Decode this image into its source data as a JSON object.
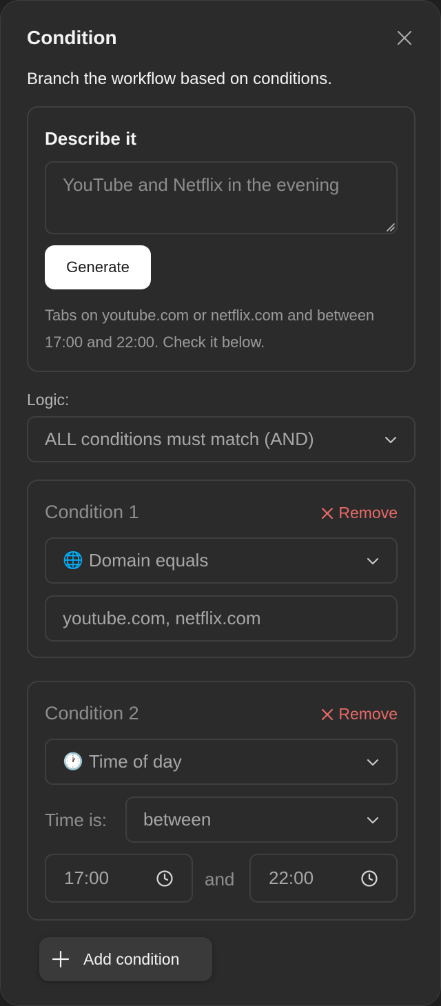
{
  "header": {
    "title": "Condition",
    "subtitle": "Branch the workflow based on conditions."
  },
  "describe": {
    "title": "Describe it",
    "placeholder": "YouTube and Netflix in the evening",
    "generate_label": "Generate",
    "hint": "Tabs on youtube.com or netflix.com and between 17:00 and 22:00. Check it below."
  },
  "logic": {
    "label": "Logic:",
    "selected": "ALL conditions must match (AND)"
  },
  "conditions": [
    {
      "title": "Condition 1",
      "remove_label": "Remove",
      "type_icon": "🌐",
      "type_label": "Domain equals",
      "value_placeholder": "youtube.com, netflix.com"
    },
    {
      "title": "Condition 2",
      "remove_label": "Remove",
      "type_icon": "🕐",
      "type_label": "Time of day",
      "time_label": "Time is:",
      "operator": "between",
      "start": "17:00",
      "and_label": "and",
      "end": "22:00"
    }
  ],
  "footer": {
    "add_label": "Add condition"
  },
  "colors": {
    "background": "#2b2b2b",
    "border": "#3f3f3f",
    "remove": "#e86a67",
    "primary_button": "#ffffff"
  },
  "icons": [
    "close-icon",
    "chevron-down-icon",
    "globe-icon",
    "clock-icon",
    "x-icon",
    "plus-icon",
    "resize-grip-icon"
  ]
}
